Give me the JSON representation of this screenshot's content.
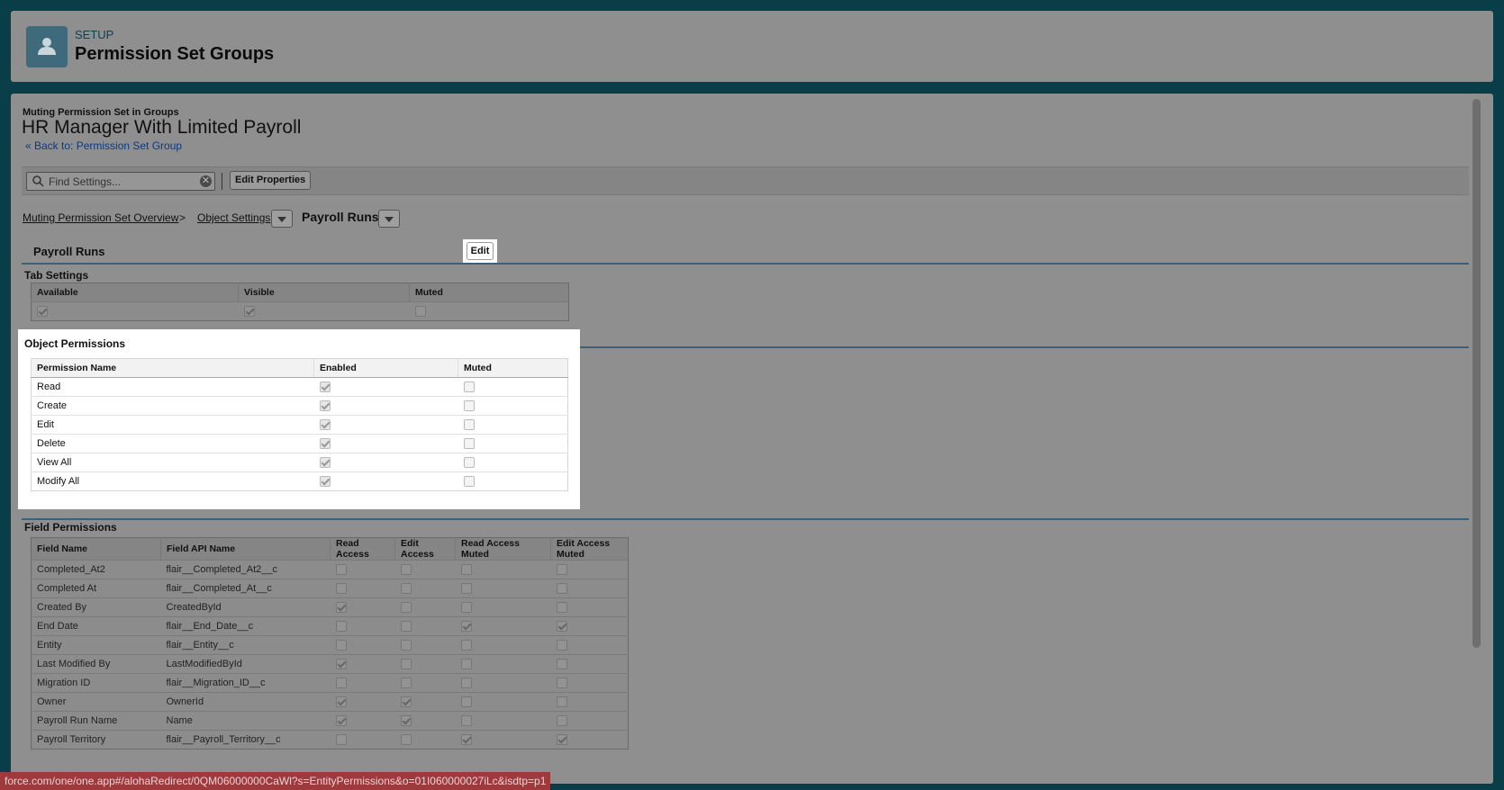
{
  "header": {
    "subtitle": "SETUP",
    "title": "Permission Set Groups"
  },
  "page": {
    "pretitle": "Muting Permission Set in Groups",
    "title": "HR Manager With Limited Payroll",
    "back_link": "« Back to: Permission Set Group"
  },
  "toolbar": {
    "search_placeholder": "Find Settings...",
    "edit_properties": "Edit Properties"
  },
  "breadcrumb": {
    "overview": "Muting Permission Set Overview",
    "separator": ">",
    "object_settings": "Object Settings",
    "current": "Payroll Runs"
  },
  "object": {
    "title": "Payroll Runs",
    "edit_label": "Edit"
  },
  "tab_settings": {
    "title": "Tab Settings",
    "headers": [
      "Available",
      "Visible",
      "Muted"
    ],
    "row": [
      true,
      true,
      false
    ]
  },
  "object_permissions": {
    "title": "Object Permissions",
    "headers": [
      "Permission Name",
      "Enabled",
      "Muted"
    ],
    "rows": [
      {
        "name": "Read",
        "enabled": true,
        "muted": false
      },
      {
        "name": "Create",
        "enabled": true,
        "muted": false
      },
      {
        "name": "Edit",
        "enabled": true,
        "muted": false
      },
      {
        "name": "Delete",
        "enabled": true,
        "muted": false
      },
      {
        "name": "View All",
        "enabled": true,
        "muted": false
      },
      {
        "name": "Modify All",
        "enabled": true,
        "muted": false
      }
    ]
  },
  "field_permissions": {
    "title": "Field Permissions",
    "headers": [
      "Field Name",
      "Field API Name",
      "Read Access",
      "Edit Access",
      "Read Access Muted",
      "Edit Access Muted"
    ],
    "rows": [
      {
        "name": "Completed_At2",
        "api": "flair__Completed_At2__c",
        "flags": [
          false,
          false,
          false,
          false
        ]
      },
      {
        "name": "Completed At",
        "api": "flair__Completed_At__c",
        "flags": [
          false,
          false,
          false,
          false
        ]
      },
      {
        "name": "Created By",
        "api": "CreatedById",
        "flags": [
          true,
          false,
          false,
          false
        ]
      },
      {
        "name": "End Date",
        "api": "flair__End_Date__c",
        "flags": [
          false,
          false,
          true,
          true
        ]
      },
      {
        "name": "Entity",
        "api": "flair__Entity__c",
        "flags": [
          false,
          false,
          false,
          false
        ]
      },
      {
        "name": "Last Modified By",
        "api": "LastModifiedById",
        "flags": [
          true,
          false,
          false,
          false
        ]
      },
      {
        "name": "Migration ID",
        "api": "flair__Migration_ID__c",
        "flags": [
          false,
          false,
          false,
          false
        ]
      },
      {
        "name": "Owner",
        "api": "OwnerId",
        "flags": [
          true,
          true,
          false,
          false
        ]
      },
      {
        "name": "Payroll Run Name",
        "api": "Name",
        "flags": [
          true,
          true,
          false,
          false
        ]
      },
      {
        "name": "Payroll Territory",
        "api": "flair__Payroll_Territory__c",
        "flags": [
          false,
          false,
          true,
          true
        ]
      }
    ]
  },
  "status_url": "force.com/one/one.app#/alohaRedirect/0QM06000000CaWl?s=EntityPermissions&o=01I060000027iLc&isdtp=p1"
}
